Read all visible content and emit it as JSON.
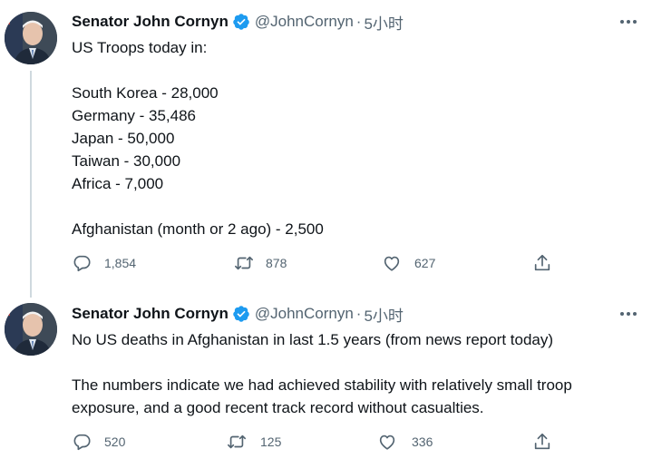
{
  "tweets": [
    {
      "display_name": "Senator John Cornyn",
      "handle": "@JohnCornyn",
      "separator": "·",
      "time": "5小时",
      "text": "US Troops today in:\n\nSouth Korea - 28,000\nGermany - 35,486\nJapan - 50,000\nTaiwan - 30,000\nAfrica - 7,000\n\nAfghanistan (month or 2 ago) - 2,500",
      "replies": "1,854",
      "retweets": "878",
      "likes": "627"
    },
    {
      "display_name": "Senator John Cornyn",
      "handle": "@JohnCornyn",
      "separator": "·",
      "time": "5小时",
      "text": "No US deaths in Afghanistan in last 1.5 years (from news report today)\n\nThe numbers indicate we had achieved stability with relatively small troop exposure, and a good recent track record without casualties.",
      "replies": "520",
      "retweets": "125",
      "likes": "336"
    }
  ],
  "icons": {
    "verified": "verified-badge-icon",
    "more": "more-dots-icon",
    "reply": "reply-bubble-icon",
    "retweet": "retweet-arrows-icon",
    "like": "heart-icon",
    "share": "share-upload-icon"
  },
  "colors": {
    "text": "#0f1419",
    "secondary": "#536471",
    "verified": "#1d9bf0",
    "thread_line": "#cfd9de"
  }
}
